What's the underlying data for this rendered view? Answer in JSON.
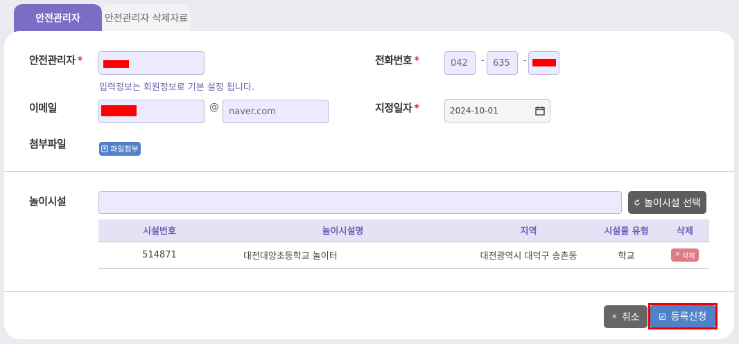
{
  "tabs": {
    "active": "안전관리자",
    "inactive": "안전관리자 삭제자료"
  },
  "form": {
    "manager_label": "안전관리자",
    "required_mark": "*",
    "manager_help": "입력정보는 회원정보로 기본 설정 됩니다.",
    "phone_label": "전화번호",
    "phone_part1": "042",
    "phone_part2": "635",
    "phone_sep": "-",
    "email_label": "이메일",
    "email_at": "@",
    "email_domain": "naver.com",
    "date_label": "지정일자",
    "date_value": "2024-10-01",
    "attach_label": "첨부파일",
    "attach_button": "파일첨부"
  },
  "facility": {
    "label": "놀이시설",
    "select_button": "놀이시설 선택",
    "columns": [
      "시설번호",
      "놀이시설명",
      "지역",
      "시설물 유형",
      "삭제"
    ],
    "rows": [
      {
        "id": "514871",
        "name": "대전대양초등학교 놀이터",
        "region": "대전광역시 대덕구 송촌동",
        "type": "학교",
        "delete": "삭제"
      }
    ]
  },
  "actions": {
    "cancel": "취소",
    "submit": "등록신청"
  },
  "colors": {
    "accent": "#7b6cc4",
    "primary_button": "#4f82c9",
    "required": "#e0262c",
    "highlight": "#ee0000"
  },
  "icons": {
    "calendar": "calendar-icon",
    "upload": "upload-icon",
    "refresh": "refresh-icon",
    "close": "close-icon",
    "check": "check-icon"
  }
}
